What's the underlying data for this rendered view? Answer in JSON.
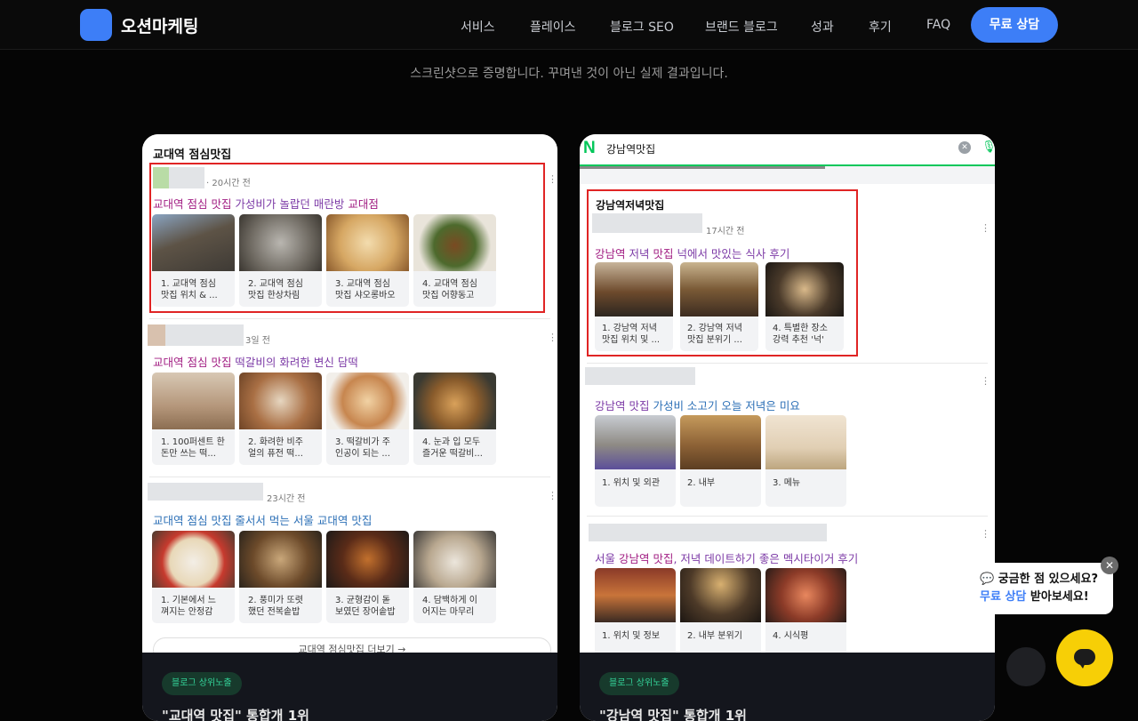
{
  "header": {
    "brand": "오션마케팅",
    "nav": [
      "서비스",
      "플레이스",
      "블로그 SEO",
      "브랜드 블로그",
      "성과",
      "후기",
      "FAQ"
    ],
    "cta": "무료 상담"
  },
  "subtitle": "스크린샷으로 증명합니다. 꾸며낸 것이 아닌 실제 결과입니다.",
  "left_card": {
    "query": "교대역 점심맛집",
    "posts": [
      {
        "meta": "20시간 전",
        "title_kw": "교대역 점심 맛집",
        "title_rest": " 가성비가 놀랍던 매란방 ",
        "title_kw2": "교대점",
        "captions": [
          "1. 교대역 점심\n맛집 위치 & ...",
          "2. 교대역 점심\n맛집 한상차림",
          "3. 교대역 점심\n맛집 샤오롱바오",
          "4. 교대역 점심\n맛집 어향동고"
        ]
      },
      {
        "meta": "3일 전",
        "title_kw": "교대역 점심 맛집",
        "title_rest": " 떡갈비의 화려한 변신 담떡",
        "captions": [
          "1. 100퍼센트 한\n돈만 쓰는 떡...",
          "2. 화려한 비주\n얼의 퓨전 떡...",
          "3. 떡갈비가 주\n인공이 되는 ...",
          "4. 눈과 입 모두\n즐거운 떡갈비..."
        ]
      },
      {
        "meta": "23시간 전",
        "title_kw": "교대역 점심 맛집",
        "title_rest": " 줄서서 먹는 서울 ",
        "title_kw2": "교대역 맛집",
        "captions": [
          "1. 기본에서 느\n껴지는 안정감",
          "2. 풍미가 또렷\n했던 전복솥밥",
          "3. 균형감이 돋\n보였던 장어솥밥",
          "4. 담백하게 이\n어지는 마무리"
        ]
      }
    ],
    "more": "교대역 점심맛집 더보기 →",
    "pill": "블로그 상위노출",
    "card_title": "\"교대역 맛집\" 통합개 1위"
  },
  "right_card": {
    "search_query": "강남역맛집",
    "posts": [
      {
        "heading": "강남역저녁맛집",
        "meta": "17시간 전",
        "title_kw": "강남역",
        "title_mid": " 저녁 ",
        "title_kw2": "맛집",
        "title_rest": " 넉에서 맛있는 식사 후기",
        "captions": [
          "1. 강남역 저녁\n맛집 위치 및 ...",
          "2. 강남역 저녁\n맛집 분위기 ...",
          "4. 특별한 장소\n강력 추천 '넉'"
        ]
      },
      {
        "title_kw": "강남역 맛집",
        "title_rest": " 가성비 소고기 오늘 저녁은 미요",
        "captions": [
          "1. 위치 및 외관",
          "2. 내부",
          "3. 메뉴"
        ]
      },
      {
        "title_pre": "서울 ",
        "title_kw": "강남역 맛집",
        "title_rest": ", 저녁 데이트하기 좋은 멕시타이거 후기",
        "captions": [
          "1. 위치 및 정보",
          "2. 내부 분위기",
          "4. 시식평"
        ]
      }
    ],
    "pill": "블로그 상위노출",
    "card_title": "\"강남역 맛집\" 통합개 1위"
  },
  "chat": {
    "line1": "💬 궁금한 점 있으세요?",
    "line2_hl": "무료 상담",
    "line2_rest": " 받아보세요!"
  },
  "colors": {
    "accent": "#3d7ef7",
    "naver_green": "#03c75a",
    "chat_yellow": "#f7cf06",
    "highlight_red": "#e02424"
  }
}
